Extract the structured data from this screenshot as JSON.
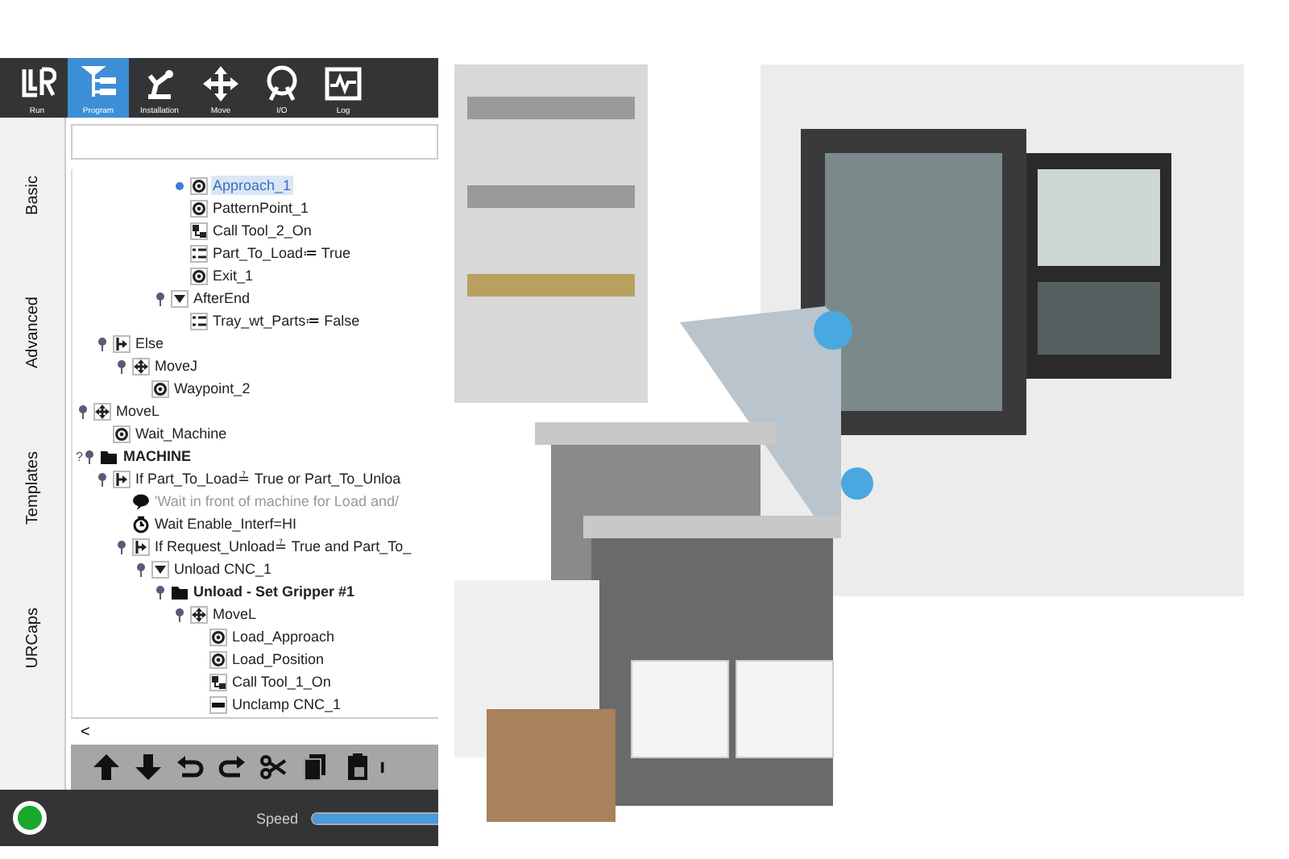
{
  "top_tabs": [
    {
      "label": "Run",
      "selected": false
    },
    {
      "label": "Program",
      "selected": true
    },
    {
      "label": "Installation",
      "selected": false
    },
    {
      "label": "Move",
      "selected": false
    },
    {
      "label": "I/O",
      "selected": false
    },
    {
      "label": "Log",
      "selected": false
    }
  ],
  "side_tabs": [
    {
      "label": "Basic",
      "selected": false
    },
    {
      "label": "Advanced",
      "selected": false
    },
    {
      "label": "Templates",
      "selected": false
    },
    {
      "label": "URCaps",
      "selected": false
    }
  ],
  "tree": [
    {
      "children": [
        {
          "children": [
            {
              "children": [
                {
                  "children": [
                    {
                      "children": [
                        {
                          "label": "Approach_1",
                          "kind": "waypoint",
                          "selected": true
                        },
                        {
                          "label": "PatternPoint_1",
                          "kind": "waypoint",
                          "selected": false
                        },
                        {
                          "label": "Call Tool_2_On",
                          "kind": "call",
                          "selected": false
                        },
                        {
                          "label": "Part_To_Load≔ True",
                          "kind": "assign",
                          "selected": false
                        },
                        {
                          "label": "Exit_1",
                          "kind": "waypoint",
                          "selected": false
                        }
                      ]
                    },
                    {
                      "label": "AfterEnd",
                      "kind": "toggle",
                      "selected": false,
                      "expanded": true,
                      "children": [
                        {
                          "label": "Tray_wt_Parts≔ False",
                          "kind": "assign",
                          "selected": false
                        }
                      ]
                    }
                  ]
                }
              ]
            }
          ]
        },
        {
          "label": "Else",
          "kind": "branch",
          "selected": false,
          "expanded": true,
          "children": [
            {
              "label": "MoveJ",
              "kind": "move",
              "selected": false,
              "expanded": true,
              "children": [
                {
                  "label": "Waypoint_2",
                  "kind": "waypoint",
                  "selected": false
                }
              ]
            }
          ]
        }
      ]
    },
    {
      "label": "MoveL",
      "kind": "move",
      "selected": false,
      "expanded": true,
      "children": [
        {
          "label": "Wait_Machine",
          "kind": "waypoint",
          "selected": false
        }
      ]
    },
    {
      "label": "MACHINE",
      "kind": "folder",
      "selected": false,
      "expanded": true,
      "flag": "?",
      "children": [
        {
          "label": "If Part_To_Load≟ True  or Part_To_Unloa",
          "kind": "branch",
          "selected": false,
          "expanded": true,
          "children": [
            {
              "label": "'Wait in front of machine for Load and/",
              "kind": "comment",
              "selected": false
            },
            {
              "label": "Wait Enable_Interf=HI",
              "kind": "wait",
              "selected": false
            },
            {
              "label": "If Request_Unload≟ True  and Part_To_",
              "kind": "branch",
              "selected": false,
              "expanded": true,
              "children": [
                {
                  "label": "Unload CNC_1",
                  "kind": "toggle",
                  "selected": false,
                  "expanded": true,
                  "children": [
                    {
                      "label": "Unload - Set Gripper #1",
                      "kind": "folder",
                      "selected": false,
                      "expanded": true,
                      "children": [
                        {
                          "label": "MoveL",
                          "kind": "move",
                          "selected": false,
                          "expanded": true,
                          "children": [
                            {
                              "label": "Load_Approach",
                              "kind": "waypoint",
                              "selected": false
                            },
                            {
                              "label": "Load_Position",
                              "kind": "waypoint",
                              "selected": false
                            },
                            {
                              "label": "Call Tool_1_On",
                              "kind": "call",
                              "selected": false
                            },
                            {
                              "label": "Unclamp CNC_1",
                              "kind": "set",
                              "selected": false
                            }
                          ]
                        }
                      ]
                    }
                  ]
                }
              ]
            }
          ]
        }
      ]
    }
  ],
  "scroll_left": "<",
  "status": {
    "running": true
  },
  "speed": {
    "label": "Speed",
    "level": 1
  }
}
